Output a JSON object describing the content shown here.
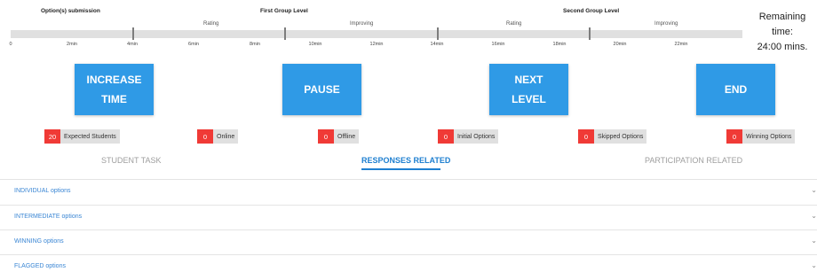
{
  "timeline": {
    "phases": [
      {
        "title": "Option(s) submission"
      },
      {
        "title": "First Group Level",
        "subs": [
          "Rating",
          "Improving"
        ]
      },
      {
        "title": "Second Group Level",
        "subs": [
          "Rating",
          "Improving"
        ]
      }
    ],
    "ticks": [
      "0",
      "2min",
      "4min",
      "6min",
      "8min",
      "10min",
      "12min",
      "14min",
      "16min",
      "18min",
      "20min",
      "22min"
    ]
  },
  "remaining": {
    "label": "Remaining time:",
    "value": "24:00 mins."
  },
  "actions": {
    "increase_line1": "INCREASE",
    "increase_line2": "TIME",
    "pause": "PAUSE",
    "next_line1": "NEXT",
    "next_line2": "LEVEL",
    "end": "END"
  },
  "stats": [
    {
      "count": "20",
      "label": "Expected Students"
    },
    {
      "count": "0",
      "label": "Online"
    },
    {
      "count": "0",
      "label": "Offline"
    },
    {
      "count": "0",
      "label": "Initial Options"
    },
    {
      "count": "0",
      "label": "Skipped Options"
    },
    {
      "count": "0",
      "label": "Winning Options"
    }
  ],
  "tabs": [
    {
      "label": "STUDENT TASK"
    },
    {
      "label": "RESPONSES RELATED"
    },
    {
      "label": "PARTICIPATION RELATED"
    }
  ],
  "accordion": [
    {
      "label": "INDIVIDUAL options"
    },
    {
      "label": "INTERMEDIATE options"
    },
    {
      "label": "WINNING options"
    },
    {
      "label": "FLAGGED options"
    }
  ],
  "colors": {
    "accent": "#2f9ae6",
    "badge": "#f03a36",
    "tab_active": "#1e7fd0"
  }
}
